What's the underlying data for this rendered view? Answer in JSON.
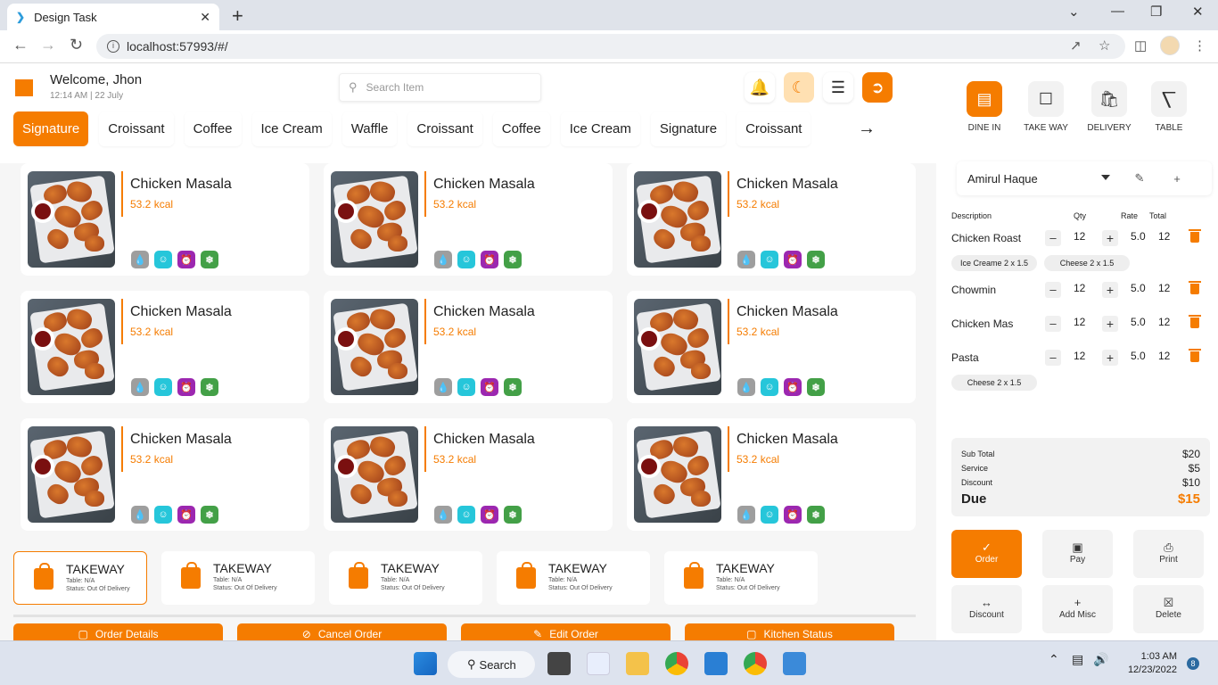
{
  "browser": {
    "tab_title": "Design Task",
    "url": "localhost:57993/#/"
  },
  "header": {
    "welcome": "Welcome, Jhon",
    "datetime": "12:14 AM | 22 July",
    "search_placeholder": "Search Item"
  },
  "categories": [
    "Signature",
    "Croissant",
    "Coffee",
    "Ice Cream",
    "Waffle",
    "Croissant",
    "Coffee",
    "Ice Cream",
    "Signature",
    "Croissant"
  ],
  "menu_items": [
    {
      "name": "Chicken Masala",
      "kcal": "53.2 kcal"
    },
    {
      "name": "Chicken Masala",
      "kcal": "53.2 kcal"
    },
    {
      "name": "Chicken Masala",
      "kcal": "53.2 kcal"
    },
    {
      "name": "Chicken Masala",
      "kcal": "53.2 kcal"
    },
    {
      "name": "Chicken Masala",
      "kcal": "53.2 kcal"
    },
    {
      "name": "Chicken Masala",
      "kcal": "53.2 kcal"
    },
    {
      "name": "Chicken Masala",
      "kcal": "53.2 kcal"
    },
    {
      "name": "Chicken Masala",
      "kcal": "53.2 kcal"
    },
    {
      "name": "Chicken Masala",
      "kcal": "53.2 kcal"
    }
  ],
  "tag_icons": [
    {
      "name": "drop-icon",
      "color": "#9e9e9e"
    },
    {
      "name": "smile-icon",
      "color": "#26c6da"
    },
    {
      "name": "alarm-icon",
      "color": "#9c27b0"
    },
    {
      "name": "snowflake-icon",
      "color": "#43a047"
    }
  ],
  "orders": [
    {
      "type": "TAKEWAY",
      "table": "Table: N/A",
      "status": "Status: Out Of Delivery"
    },
    {
      "type": "TAKEWAY",
      "table": "Table: N/A",
      "status": "Status: Out Of Delivery"
    },
    {
      "type": "TAKEWAY",
      "table": "Table: N/A",
      "status": "Status: Out Of Delivery"
    },
    {
      "type": "TAKEWAY",
      "table": "Table: N/A",
      "status": "Status: Out Of Delivery"
    },
    {
      "type": "TAKEWAY",
      "table": "Table: N/A",
      "status": "Status: Out Of Delivery"
    }
  ],
  "actions": [
    "Order Details",
    "Cancel Order",
    "Edit Order",
    "Kitchen Status"
  ],
  "modes": [
    "DINE IN",
    "TAKE WAY",
    "DELIVERY",
    "TABLE"
  ],
  "customer": "Amirul Haque",
  "table_headers": {
    "description": "Description",
    "qty": "Qty",
    "rate": "Rate",
    "total": "Total"
  },
  "cart": [
    {
      "name": "Chicken Roast",
      "qty": "12",
      "rate": "5.0",
      "total": "12"
    },
    {
      "name": "Chowmin",
      "qty": "12",
      "rate": "5.0",
      "total": "12"
    },
    {
      "name": "Chicken Mas",
      "qty": "12",
      "rate": "5.0",
      "total": "12"
    },
    {
      "name": "Pasta",
      "qty": "12",
      "rate": "5.0",
      "total": "12"
    }
  ],
  "chips": [
    "Ice Creame 2 x 1.5",
    "Cheese 2 x 1.5",
    "Cheese 2 x 1.5"
  ],
  "summary": {
    "subtotal_label": "Sub Total",
    "subtotal": "$20",
    "service_label": "Service",
    "service": "$5",
    "discount_label": "Discount",
    "discount": "$10",
    "due_label": "Due",
    "due": "$15"
  },
  "pay_buttons": [
    "Order",
    "Pay",
    "Print",
    "Discount",
    "Add Misc",
    "Delete"
  ],
  "taskbar": {
    "search": "Search",
    "time": "1:03 AM",
    "date": "12/23/2022",
    "notifications": "8"
  },
  "colors": {
    "accent": "#f57c00"
  }
}
